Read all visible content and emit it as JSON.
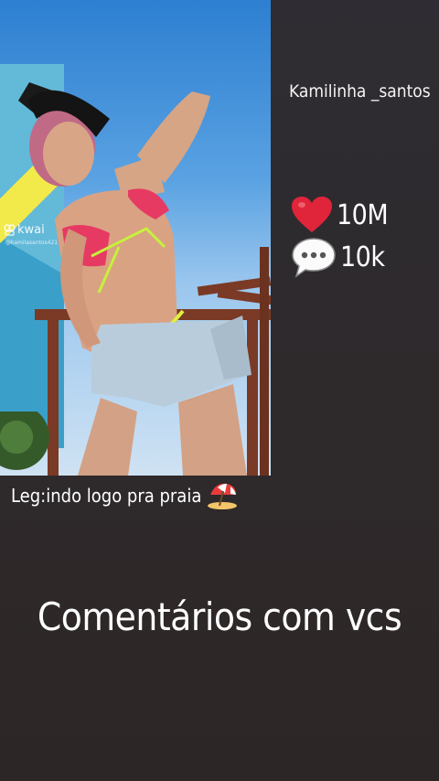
{
  "post": {
    "username": "Kamilinha _santos",
    "likes": "10M",
    "comments": "10k",
    "caption": "Leg:indo logo pra praia",
    "cta": "Comentários com vcs"
  },
  "video": {
    "watermark": "kwai",
    "handle": "@kamilasantos421"
  },
  "icons": {
    "likes": "heart-icon",
    "comments": "speech-bubble-icon",
    "caption": "beach-umbrella-emoji"
  },
  "colors": {
    "background": "#2e2a2e",
    "heart": "#e0243a",
    "text": "#ffffff"
  }
}
